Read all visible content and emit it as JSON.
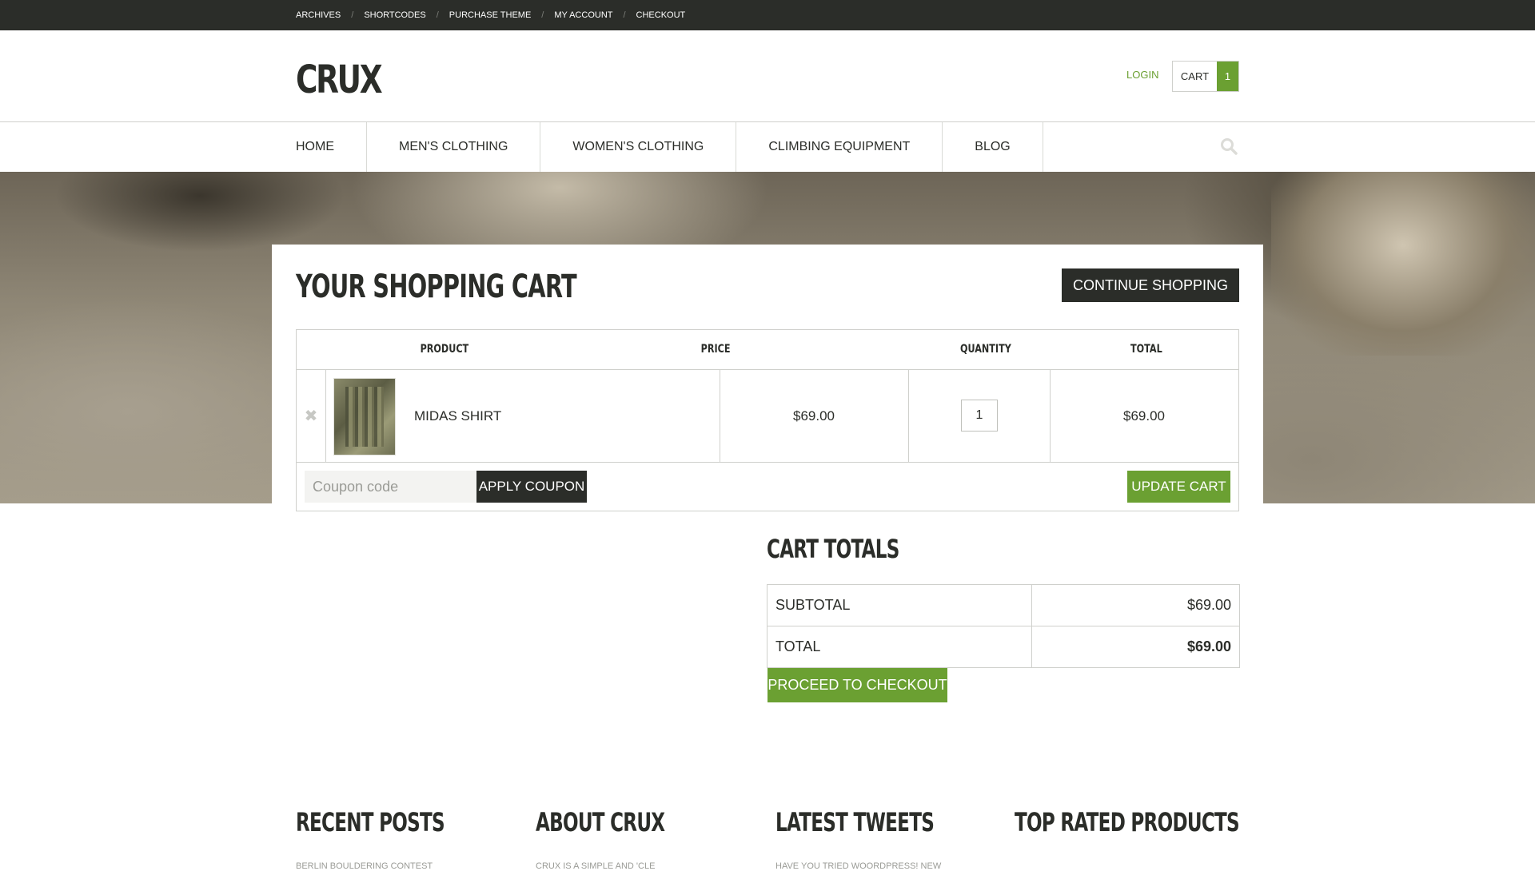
{
  "topbar": {
    "links": [
      "ARCHIVES",
      "SHORTCODES",
      "PURCHASE THEME",
      "MY ACCOUNT",
      "CHECKOUT"
    ],
    "separator": "/"
  },
  "header": {
    "logo": "CRUX",
    "login": "LOGIN",
    "cart_label": "CART",
    "cart_count": "1"
  },
  "nav": {
    "items": [
      "HOME",
      "MEN'S CLOTHING",
      "WOMEN'S CLOTHING",
      "CLIMBING EQUIPMENT",
      "BLOG"
    ],
    "search_icon": "search-icon"
  },
  "cart": {
    "title": "YOUR SHOPPING CART",
    "continue_label": "CONTINUE SHOPPING",
    "columns": {
      "product": "PRODUCT",
      "price": "PRICE",
      "quantity": "QUANTITY",
      "total": "TOTAL"
    },
    "items": [
      {
        "name": "MIDAS SHIRT",
        "price": "$69.00",
        "quantity": "1",
        "total": "$69.00",
        "remove_icon": "close-icon",
        "remove_glyph": "✖"
      }
    ],
    "coupon_placeholder": "Coupon code",
    "apply_label": "APPLY COUPON",
    "update_label": "UPDATE CART"
  },
  "totals": {
    "title": "CART TOTALS",
    "subtotal_label": "SUBTOTAL",
    "subtotal_value": "$69.00",
    "total_label": "TOTAL",
    "total_value": "$69.00",
    "checkout_label": "PROCEED TO CHECKOUT"
  },
  "footer": {
    "widgets": [
      {
        "title": "RECENT POSTS",
        "sub": "BERLIN BOULDERING CONTEST"
      },
      {
        "title": "ABOUT CRUX",
        "sub": "CRUX is a simple and 'cle"
      },
      {
        "title": "LATEST TWEETS",
        "sub": "HAVE YOU TRIED WOORDPRESS! NEW"
      },
      {
        "title": "TOP RATED PRODUCTS",
        "sub": ""
      }
    ]
  },
  "colors": {
    "dark": "#2b2d29",
    "accent": "#6ba032",
    "border": "#cfd0cc"
  }
}
